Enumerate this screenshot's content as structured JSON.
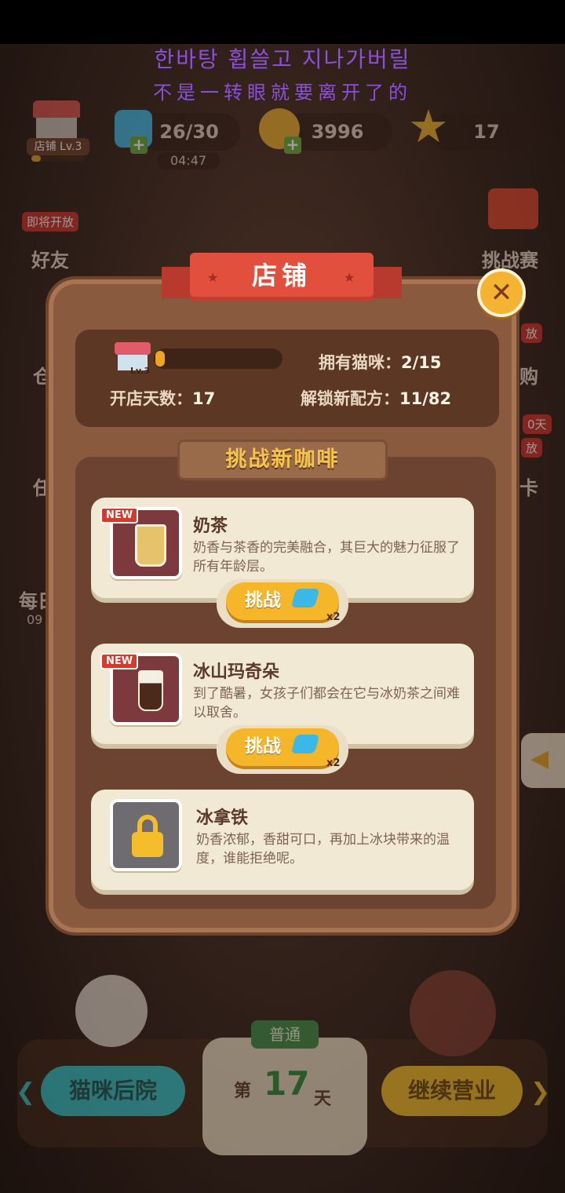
{
  "lyrics": {
    "line1": "한바탕 휩쓸고 지나가버릴",
    "line2": "不是一转眼就要离开了的"
  },
  "hud": {
    "shop_label": "店铺 Lv.3",
    "energy": "26/30",
    "energy_timer": "04:47",
    "coins": "3996",
    "stars": "17"
  },
  "side": {
    "friends_badge": "即将开放",
    "friends": "好友",
    "challenge": "挑战赛",
    "left_partial_1": "仓",
    "left_partial_2": "任",
    "left_partial_3": "每日",
    "left_partial_4": "09",
    "right_partial_1": "放",
    "right_partial_2": "购",
    "right_badge": "0天",
    "right_partial_3": "放",
    "right_partial_4": "卡"
  },
  "modal": {
    "title": "店铺",
    "close": "✕",
    "shop_level": "Lv.3",
    "owned_cats_label": "拥有猫咪：",
    "owned_cats_value": "2/15",
    "days_label": "开店天数：",
    "days_value": "17",
    "recipes_label": "解锁新配方：",
    "recipes_value": "11/82",
    "section_title": "挑战新咖啡",
    "progress": 0.05,
    "recipes": [
      {
        "new": "NEW",
        "name": "奶茶",
        "desc": "奶香与茶香的完美融合，其巨大的魅力征服了所有年龄层。",
        "button": "挑战",
        "cost": "x2",
        "locked": false
      },
      {
        "new": "NEW",
        "name": "冰山玛奇朵",
        "desc": "到了酷暑，女孩子们都会在它与冰奶茶之间难以取舍。",
        "button": "挑战",
        "cost": "x2",
        "locked": false
      },
      {
        "name": "冰拿铁",
        "desc": "奶香浓郁，香甜可口，再加上冰块带来的温度，谁能拒绝呢。",
        "locked": true
      }
    ]
  },
  "bottom": {
    "backyard": "猫咪后院",
    "mode": "普通",
    "day_prefix": "第",
    "day_num": "17",
    "day_suffix": "天",
    "continue": "继续营业"
  },
  "colors": {
    "accent_red": "#e2503d",
    "gold": "#f5b62a",
    "card": "#f2e9d4"
  }
}
